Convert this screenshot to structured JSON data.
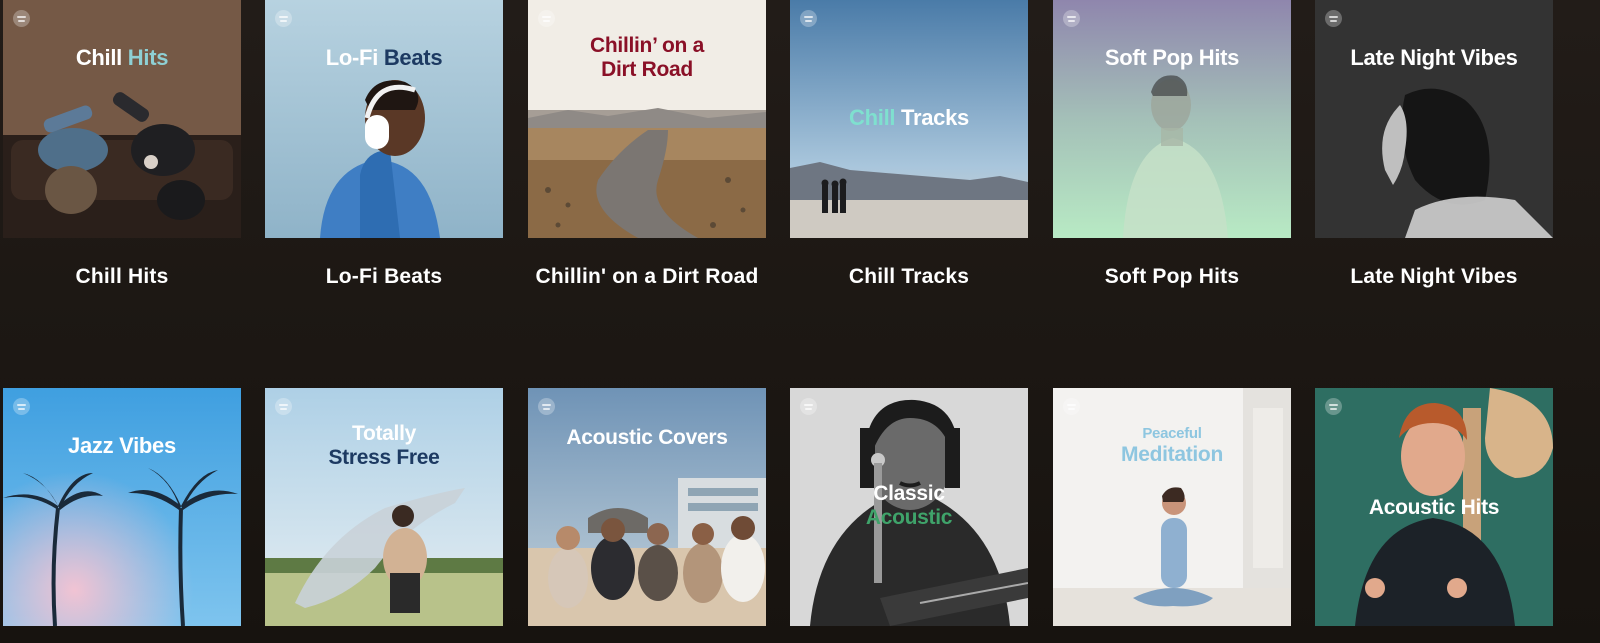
{
  "row1": [
    {
      "label": "Chill Hits",
      "cover_a": "Chill",
      "cover_b": "Hits"
    },
    {
      "label": "Lo-Fi Beats",
      "cover_a": "Lo-Fi",
      "cover_b": "Beats"
    },
    {
      "label": "Chillin' on a Dirt Road",
      "cover_a": "Chillin’ on a",
      "cover_b": "Dirt Road"
    },
    {
      "label": "Chill Tracks",
      "cover_a": "Chill",
      "cover_b": "Tracks"
    },
    {
      "label": "Soft Pop Hits",
      "cover_a": "Soft Pop Hits"
    },
    {
      "label": "Late Night Vibes",
      "cover_a": "Late Night Vibes"
    }
  ],
  "row2": [
    {
      "cover_a": "Jazz Vibes"
    },
    {
      "cover_a": "Totally",
      "cover_b": "Stress Free"
    },
    {
      "cover_a": "Acoustic Covers"
    },
    {
      "cover_a": "Classic",
      "cover_b": "Acoustic"
    },
    {
      "cover_a": "Peaceful",
      "cover_b": "Meditation"
    },
    {
      "cover_a": "Acoustic Hits"
    }
  ],
  "icons": {
    "cover_badge": "spotify-logo-icon"
  },
  "colors": {
    "background": "#1a1614",
    "label_text": "#ffffff"
  }
}
